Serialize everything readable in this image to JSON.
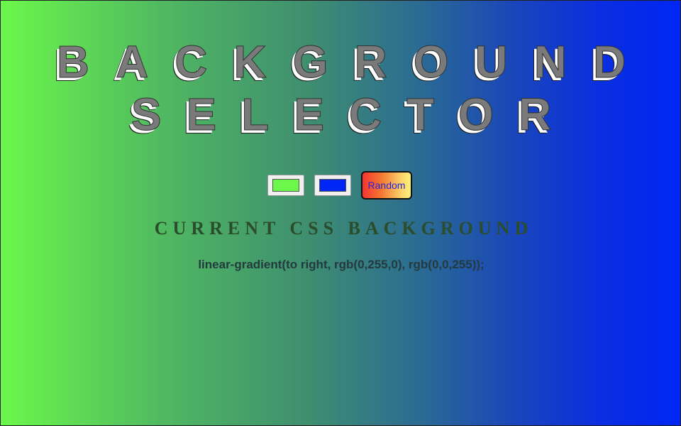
{
  "title": {
    "line1": "BACKGROUND",
    "line2": "SELECTOR"
  },
  "controls": {
    "color1": "#6cf74b",
    "color2": "#0026f5",
    "random_label": "Random"
  },
  "subtitle": "CURRENT CSS BACKGROUND",
  "css_value": "linear-gradient(to right, rgb(0,255,0), rgb(0,0,255));"
}
